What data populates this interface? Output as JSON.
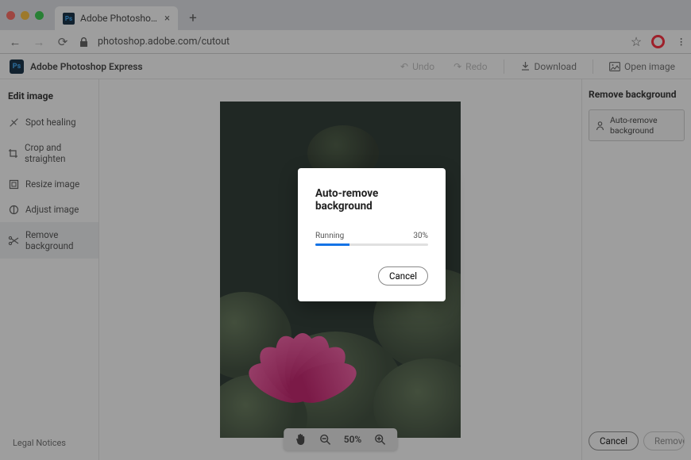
{
  "tab": {
    "title": "Adobe Photoshop Express"
  },
  "url": "photoshop.adobe.com/cutout",
  "app": {
    "name": "Adobe Photoshop Express",
    "undo": "Undo",
    "redo": "Redo",
    "download": "Download",
    "open": "Open image"
  },
  "sidebar": {
    "heading": "Edit image",
    "items": [
      {
        "label": "Spot healing"
      },
      {
        "label": "Crop and straighten"
      },
      {
        "label": "Resize image"
      },
      {
        "label": "Adjust image"
      },
      {
        "label": "Remove background"
      }
    ],
    "legal": "Legal Notices"
  },
  "zoom": {
    "level": "50%"
  },
  "right": {
    "heading": "Remove background",
    "auto_btn": "Auto-remove background",
    "cancel": "Cancel",
    "remove": "Remove ba"
  },
  "modal": {
    "title": "Auto-remove background",
    "status": "Running",
    "percent": "30%",
    "progress": 30,
    "cancel": "Cancel"
  }
}
